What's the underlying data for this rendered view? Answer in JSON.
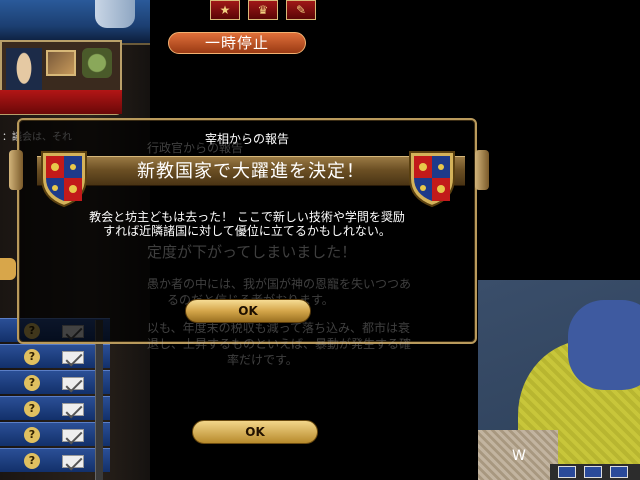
{
  "top_bar": {
    "pause_label": "一時停止",
    "buttons": [
      "★",
      "♛",
      "✎"
    ]
  },
  "left_panel": {
    "snippet_lines": [
      "：議会は、それ"
    ]
  },
  "background_dialog": {
    "ghost_lines": [
      "行政官からの報告",
      "定度が下がってしまいました！",
      "愚か者の中には、我が国が神の恩寵を失いつつあ",
      "るのだと信じる者がおります。",
      "以も、年度末の税収も減って落ち込み、都市は衰",
      "退し、上昇するものといえば、暴動が発生する確",
      "率だけです。"
    ],
    "ok_label": "OK"
  },
  "map": {
    "letter": "W"
  },
  "dialog": {
    "title": "宰相からの報告",
    "headline": "新教国家で大躍進を決定！",
    "body_line1": "教会と坊主どもは去った！ ここで新しい技術や学問を奨励",
    "body_line2": "すれば近隣諸国に対して優位に立てるかもしれない。",
    "ok_label": "OK"
  },
  "colors": {
    "gold": "#b99a5c",
    "banner": "#6c5024",
    "message_row": "#2b4f96"
  },
  "icons": {
    "question": "?",
    "shield": "royal-coat-of-arms"
  }
}
